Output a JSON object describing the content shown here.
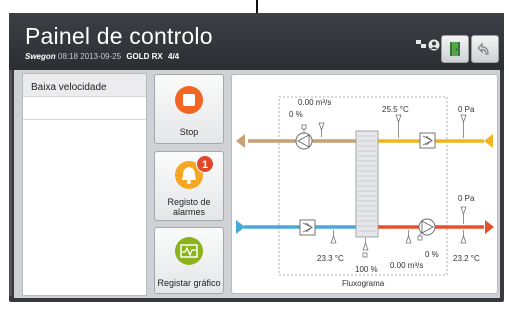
{
  "header": {
    "title": "Painel de controlo",
    "brand": "Swegon",
    "datetime": "08:18 2013-09-25",
    "model": "GOLD RX",
    "unit": "4/4",
    "icons": [
      "network-icon",
      "user-icon"
    ],
    "buttons": [
      "exit-door-icon",
      "back-arrow-icon"
    ]
  },
  "left_panel": {
    "items": [
      "Baixa velocidade",
      "",
      "",
      "",
      "",
      "",
      "",
      "",
      "",
      ""
    ]
  },
  "tiles": {
    "stop_label": "Stop",
    "alarm_label_1": "Registo de",
    "alarm_label_2": "alarmes",
    "alarm_count": "1",
    "graph_label": "Registar gráfico"
  },
  "diagram": {
    "title": "Fluxograma",
    "extract_flow": "0.00 m³/s",
    "extract_pct": "0 %",
    "extract_temp": "25.5 °C",
    "extract_pressure": "0 Pa",
    "supply_pressure": "0 Pa",
    "supply_temp": "23.2 °C",
    "outdoor_temp": "23.3 °C",
    "exchanger_pct": "100 %",
    "supply_pct": "0 %",
    "supply_flow": "0.00 m³/s"
  },
  "colors": {
    "stop": "#f26522",
    "alarm": "#f5a623",
    "graph": "#8bb31b",
    "extract_air": "#c7a073",
    "exhaust_air": "#f3b51b",
    "outdoor_air": "#4aa8d6",
    "supply_air": "#e8502a"
  }
}
